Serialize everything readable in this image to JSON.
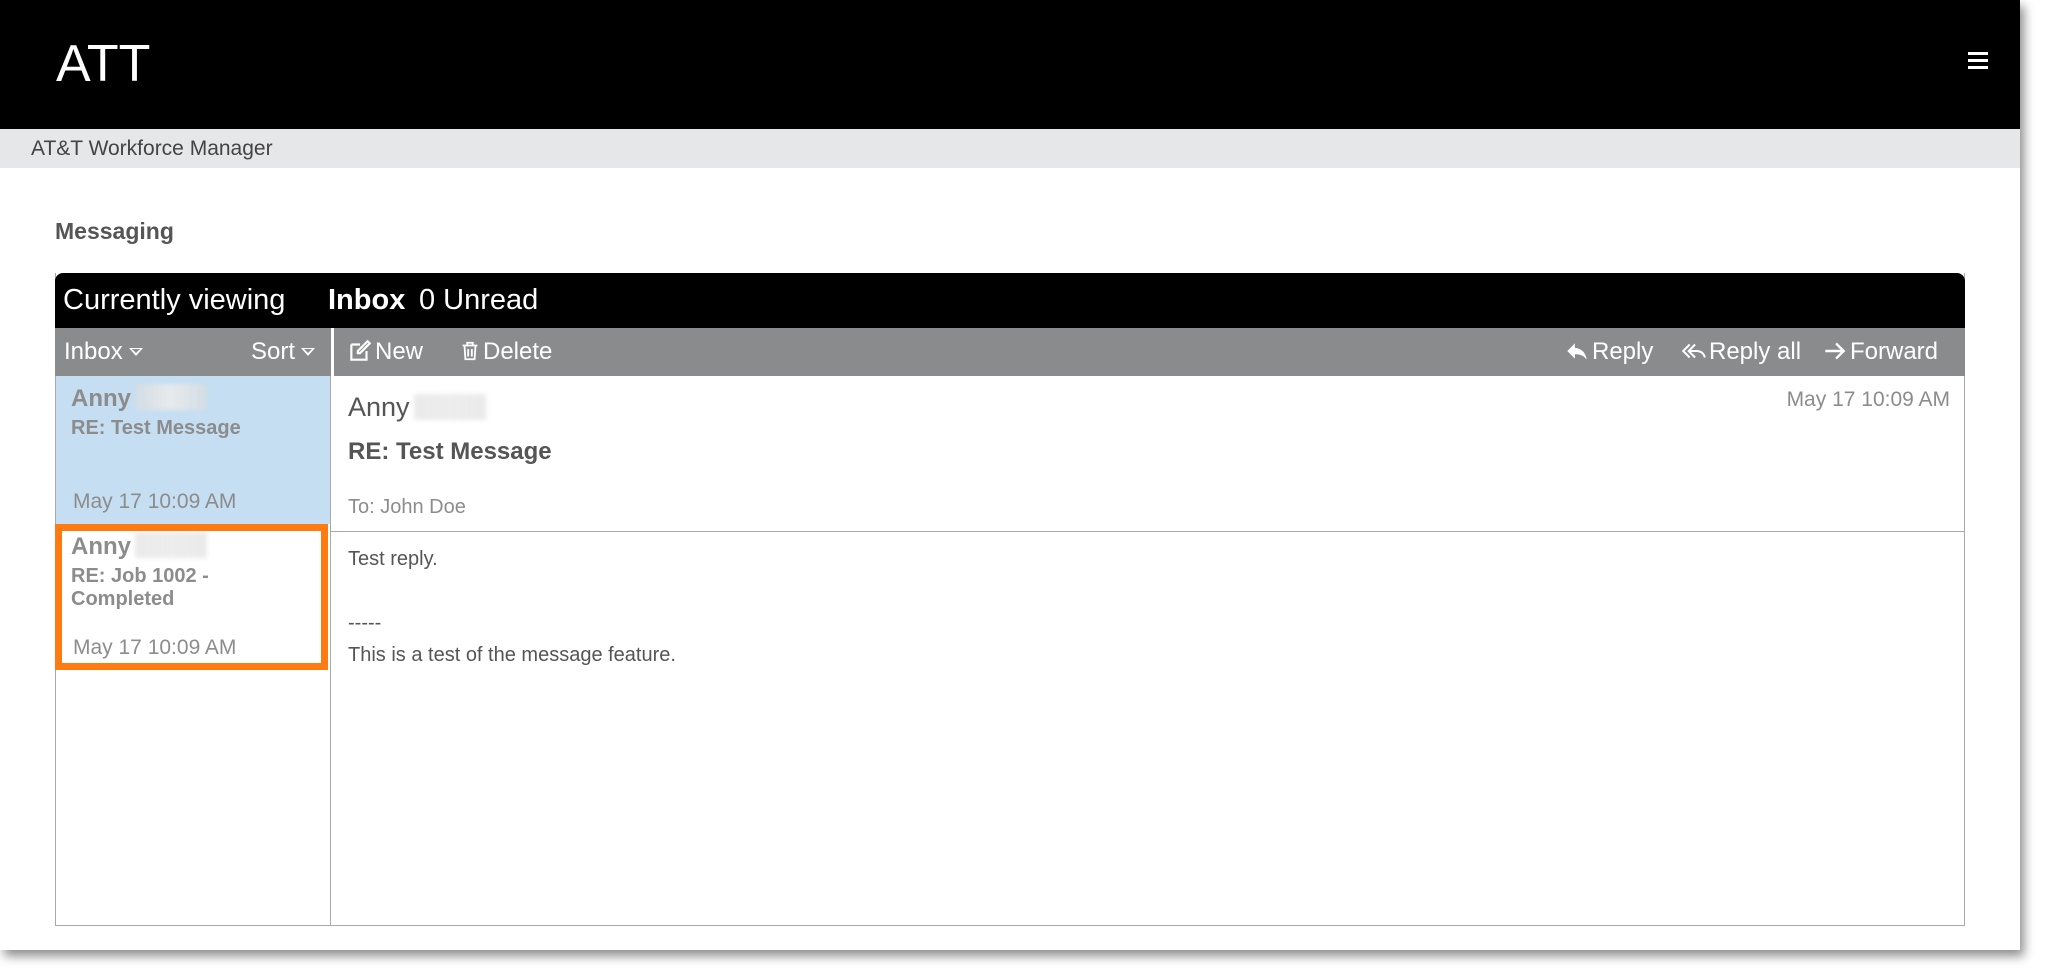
{
  "header": {
    "brand": "ATT",
    "menu_icon": "hamburger-menu-icon"
  },
  "subheader": {
    "app_name": "AT&T Workforce Manager"
  },
  "page": {
    "title": "Messaging"
  },
  "panel": {
    "viewing_label": "Currently viewing",
    "folder": "Inbox",
    "unread": "0 Unread"
  },
  "toolbar": {
    "folder_dropdown": "Inbox",
    "sort_dropdown": "Sort",
    "new": "New",
    "delete": "Delete",
    "reply": "Reply",
    "reply_all": "Reply all",
    "forward": "Forward"
  },
  "messages": [
    {
      "from": "Anny",
      "subject": "RE: Test Message",
      "date": "May 17 10:09 AM",
      "selected": true
    },
    {
      "from": "Anny",
      "subject": "RE: Job 1002 - Completed",
      "date": "May 17 10:09 AM",
      "selected": false
    }
  ],
  "reader": {
    "from": "Anny",
    "date": "May 17 10:09 AM",
    "subject": "RE: Test Message",
    "to": "To: John Doe",
    "body_line1": "Test reply.",
    "separator": "-----",
    "body_line2": "This is a test of the message feature."
  },
  "colors": {
    "header_bg": "#000000",
    "subheader_bg": "#e6e7e9",
    "toolbar_bg": "#8a8b8d",
    "selected_bg": "#c5def2",
    "highlight": "#ff7a11"
  }
}
